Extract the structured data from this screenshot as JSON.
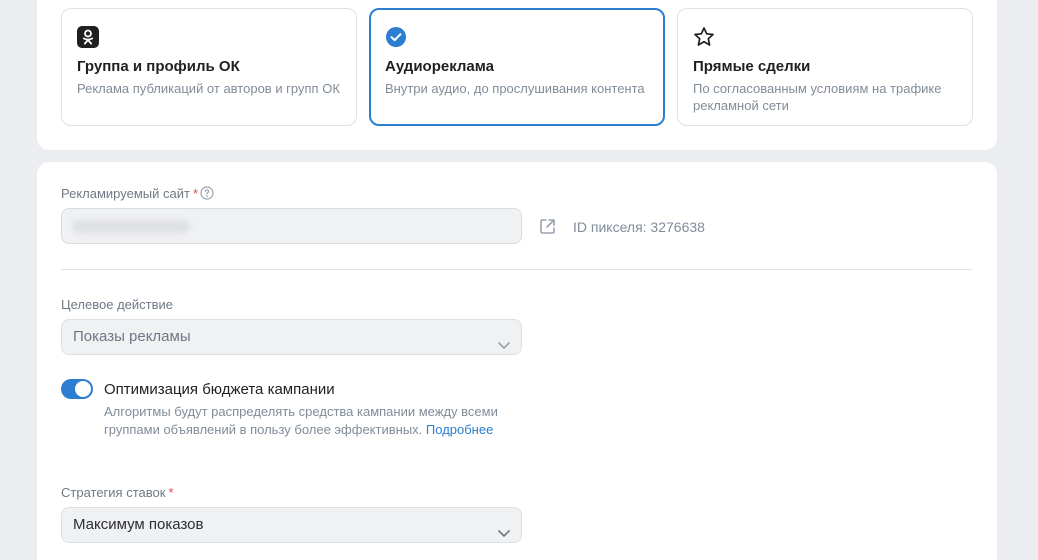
{
  "formats": [
    {
      "title": "Группа и профиль ОК",
      "description": "Реклама публикаций от авторов и групп ОК",
      "icon": "ok-logo-icon",
      "selected": false
    },
    {
      "title": "Аудиореклама",
      "description": "Внутри аудио, до прослушивания контента",
      "icon": "check-circle-icon",
      "selected": true
    },
    {
      "title": "Прямые сделки",
      "description": "По согласованным условиям на трафике рекламной сети",
      "icon": "star-icon",
      "selected": false
    }
  ],
  "site": {
    "label": "Рекламируемый сайт",
    "required_mark": "*",
    "pixel_id": "ID пикселя: 3276638"
  },
  "target_action": {
    "label": "Целевое действие",
    "value": "Показы рекламы"
  },
  "budget_optimization": {
    "title": "Оптимизация бюджета кампании",
    "description": "Алгоритмы будут распределять средства кампании между всеми группами объявлений в пользу более эффективных.",
    "link": "Подробнее",
    "enabled": true
  },
  "bid_strategy": {
    "label": "Стратегия ставок",
    "required_mark": "*",
    "value": "Максимум показов"
  },
  "colors": {
    "accent": "#2c7ed0",
    "required": "#e64646",
    "background": "#ebedf0"
  }
}
